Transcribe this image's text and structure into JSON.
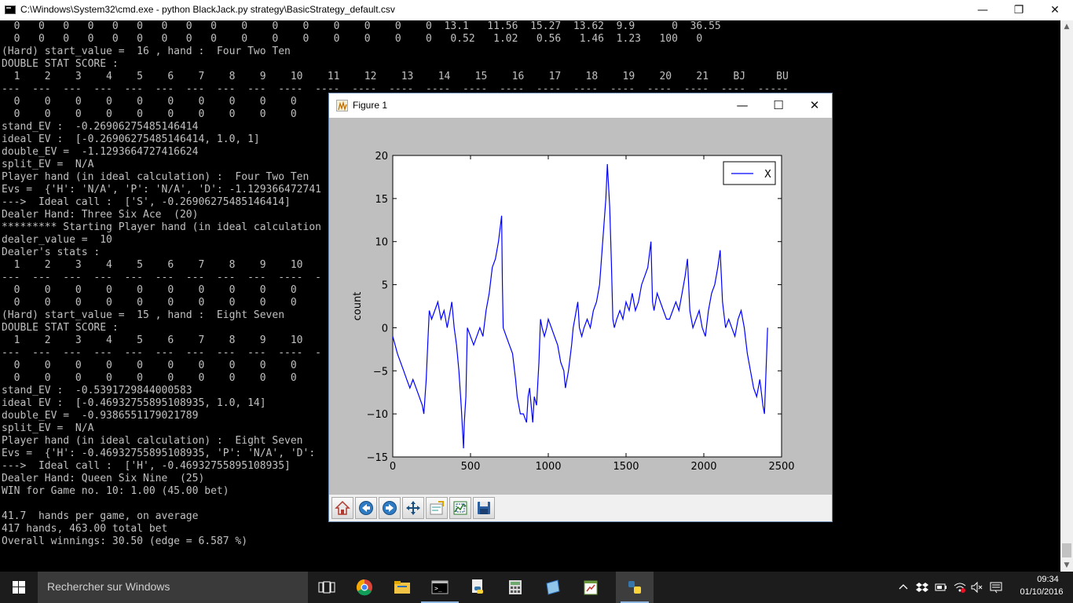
{
  "cmd": {
    "title": "C:\\Windows\\System32\\cmd.exe - python  BlackJack.py strategy\\BasicStrategy_default.csv",
    "controls": {
      "minimize": "—",
      "maximize": "❐",
      "close": "✕"
    },
    "lines": [
      "  0   0   0   0   0   0   0   0   0    0    0    0    0    0    0    0  13.1   11.56  15.27  13.62  9.9      0  36.55",
      "  0   0   0   0   0   0   0   0   0    0    0    0    0    0    0    0   0.52   1.02   0.56   1.46  1.23   100   0",
      "(Hard) start_value =  16 , hand :  Four Two Ten",
      "DOUBLE STAT SCORE :",
      "  1    2    3    4    5    6    7    8    9    10    11    12    13    14    15    16    17    18    19    20    21    BJ     BU",
      "---  ---  ---  ---  ---  ---  ---  ---  ---  ----  ----  ----  ----  ----  ----  ----  ----  ----  ----  ----  ----  ----  -----",
      "  0    0    0    0    0    0    0    0    0    0",
      "  0    0    0    0    0    0    0    0    0    0",
      "stand_EV :  -0.26906275485146414",
      "ideal EV :  [-0.26906275485146414, 1.0, 1]",
      "double_EV =  -1.1293664727416624",
      "split_EV =  N/A",
      "Player hand (in ideal calculation) :  Four Two Ten",
      "Evs =  {'H': 'N/A', 'P': 'N/A', 'D': -1.129366472741",
      "--->  Ideal call :  ['S', -0.26906275485146414]",
      "Dealer Hand: Three Six Ace  (20)",
      "********* Starting Player hand (in ideal calculation",
      "dealer_value =  10",
      "Dealer's stats :",
      "  1    2    3    4    5    6    7    8    9    10                                                                                 U",
      "---  ---  ---  ---  ---  ---  ---  ---  ---  ----  -",
      "  0    0    0    0    0    0    0    0    0    0                                                                                  4",
      "  0    0    0    0    0    0    0    0    0    0",
      "(Hard) start_value =  15 , hand :  Eight Seven",
      "DOUBLE STAT SCORE :",
      "  1    2    3    4    5    6    7    8    9    10",
      "---  ---  ---  ---  ---  ---  ---  ---  ---  ----  -",
      "  0    0    0    0    0    0    0    0    0    0",
      "  0    0    0    0    0    0    0    0    0    0",
      "stand_EV :  -0.5391729844000583",
      "ideal EV :  [-0.46932755895108935, 1.0, 14]",
      "double_EV =  -0.9386551179021789",
      "split_EV =  N/A",
      "Player hand (in ideal calculation) :  Eight Seven",
      "Evs =  {'H': -0.46932755895108935, 'P': 'N/A', 'D':",
      "--->  Ideal call :  ['H', -0.46932755895108935]",
      "Dealer Hand: Queen Six Nine  (25)",
      "WIN for Game no. 10: 1.00 (45.00 bet)",
      "",
      "41.7  hands per game, on average",
      "417 hands, 463.00 total bet",
      "Overall winnings: 30.50 (edge = 6.587 %)"
    ]
  },
  "figure": {
    "title": "Figure 1",
    "controls": {
      "minimize": "—",
      "maximize": "☐",
      "close": "✕"
    },
    "toolbar": [
      "home-icon",
      "back-icon",
      "forward-icon",
      "pan-icon",
      "configure-subplots-icon",
      "zoom-icon",
      "save-icon"
    ]
  },
  "chart_data": {
    "type": "line",
    "xlabel": "",
    "ylabel": "count",
    "xlim": [
      0,
      2500
    ],
    "ylim": [
      -15,
      20
    ],
    "xticks": [
      "0",
      "500",
      "1000",
      "1500",
      "2000",
      "2500"
    ],
    "yticks": [
      "20",
      "15",
      "10",
      "5",
      "0",
      "−5",
      "−10",
      "−15"
    ],
    "legend": {
      "position": "top-right",
      "entries": [
        "X"
      ]
    },
    "grid": false,
    "series": [
      {
        "name": "X",
        "color": "#0000ff",
        "x": [
          0,
          15,
          30,
          50,
          70,
          90,
          110,
          130,
          150,
          170,
          190,
          200,
          215,
          225,
          235,
          250,
          270,
          290,
          310,
          330,
          350,
          370,
          380,
          395,
          410,
          425,
          440,
          455,
          460,
          470,
          480,
          500,
          520,
          540,
          560,
          580,
          600,
          620,
          640,
          660,
          680,
          700,
          705,
          710,
          730,
          750,
          770,
          790,
          800,
          820,
          840,
          860,
          870,
          880,
          890,
          900,
          910,
          925,
          940,
          950,
          960,
          975,
          990,
          1000,
          1020,
          1040,
          1060,
          1080,
          1100,
          1110,
          1130,
          1150,
          1160,
          1170,
          1180,
          1190,
          1200,
          1215,
          1230,
          1250,
          1270,
          1290,
          1310,
          1330,
          1350,
          1370,
          1380,
          1395,
          1405,
          1415,
          1425,
          1440,
          1460,
          1480,
          1500,
          1520,
          1540,
          1560,
          1580,
          1600,
          1620,
          1640,
          1660,
          1670,
          1680,
          1700,
          1720,
          1740,
          1760,
          1780,
          1800,
          1820,
          1840,
          1860,
          1880,
          1895,
          1910,
          1930,
          1950,
          1970,
          1990,
          2010,
          2030,
          2050,
          2070,
          2090,
          2105,
          2120,
          2140,
          2160,
          2180,
          2200,
          2220,
          2240,
          2260,
          2280,
          2300,
          2320,
          2340,
          2360,
          2380,
          2390,
          2400,
          2410
        ],
        "y": [
          -1,
          -2,
          -3,
          -4,
          -5,
          -6,
          -7,
          -6,
          -7,
          -8,
          -9,
          -10,
          -6,
          -2,
          2,
          1,
          2,
          3,
          1,
          2,
          0,
          2,
          3,
          0,
          -2,
          -5,
          -9,
          -14,
          -11,
          -8,
          0,
          -1,
          -2,
          -1,
          0,
          -1,
          2,
          4,
          7,
          8,
          10,
          13,
          5,
          0,
          -1,
          -2,
          -3,
          -6,
          -8,
          -10,
          -10,
          -11,
          -8,
          -7,
          -9,
          -11,
          -8,
          -9,
          -4,
          1,
          0,
          -1,
          0,
          1,
          0,
          -1,
          -2,
          -4,
          -5,
          -7,
          -5,
          -2,
          0,
          1,
          2,
          3,
          0,
          -1,
          0,
          1,
          0,
          2,
          3,
          5,
          10,
          15,
          19,
          14,
          8,
          1,
          0,
          1,
          2,
          1,
          3,
          2,
          4,
          2,
          3,
          5,
          6,
          7,
          10,
          3,
          2,
          4,
          3,
          2,
          1,
          1,
          2,
          3,
          2,
          4,
          6,
          8,
          2,
          0,
          1,
          2,
          0,
          -1,
          2,
          4,
          5,
          7,
          9,
          3,
          0,
          1,
          0,
          -1,
          1,
          2,
          0,
          -3,
          -5,
          -7,
          -8,
          -6,
          -9,
          -10,
          -5,
          0
        ]
      }
    ]
  },
  "taskbar": {
    "search_placeholder": "Rechercher sur Windows",
    "apps": [
      "task-view-icon",
      "chrome-icon",
      "file-explorer-icon",
      "cmd-icon",
      "python-icon",
      "calculator-icon",
      "tablet-icon",
      "notepad-icon",
      "python-figure-icon"
    ],
    "time": "09:34",
    "date": "01/10/2016"
  }
}
